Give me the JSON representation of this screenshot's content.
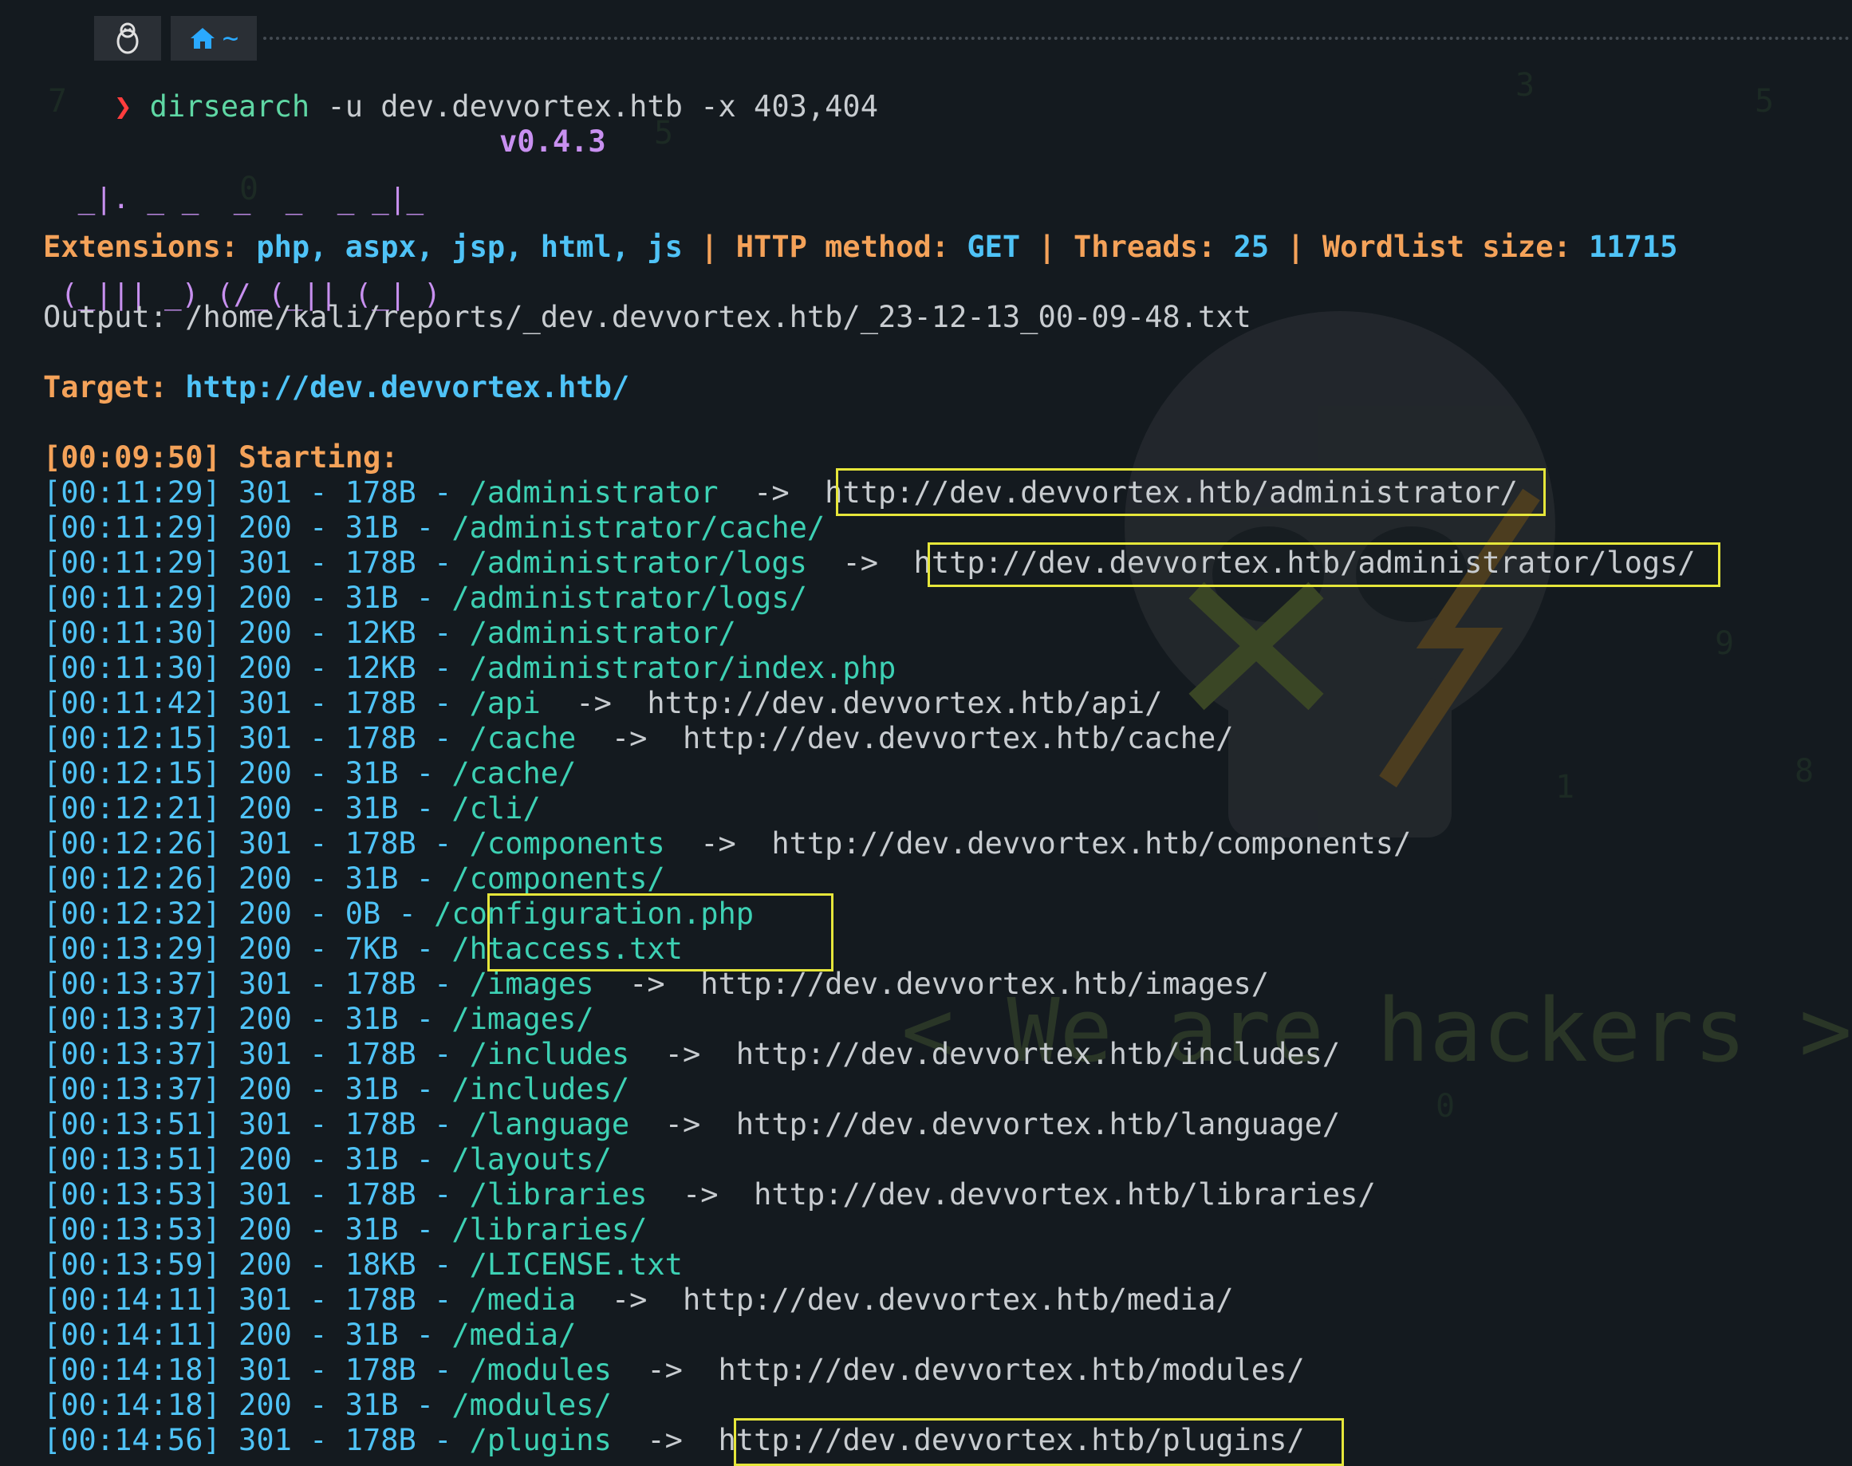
{
  "prompt": {
    "os_icon": "linux-penguin-icon",
    "home_icon": "home-icon",
    "cwd": "~"
  },
  "command": {
    "arrow": "❯",
    "name": "dirsearch",
    "args": " -u dev.devvortex.htb -x 403,404"
  },
  "banner": {
    "art_line1": " _|. _ _  _  _  _ _|_",
    "art_line2": "(_||| _) (/_(_|| (_| )",
    "version": "v0.4.3"
  },
  "config": {
    "extensions_label": "Extensions: ",
    "extensions": "php, aspx, jsp, html, js",
    "sep": " | ",
    "method_label": "HTTP method: ",
    "method": "GET",
    "threads_label": "Threads: ",
    "threads": "25",
    "wordlist_label": "Wordlist size: ",
    "wordlist": "11715"
  },
  "output": {
    "label": "Output: ",
    "path": "/home/kali/reports/_dev.devvortex.htb/_23-12-13_00-09-48.txt"
  },
  "target": {
    "label": "Target: ",
    "url": "http://dev.devvortex.htb/"
  },
  "start": {
    "time": "[00:09:50]",
    "label": " Starting:"
  },
  "results": [
    {
      "time": "[00:11:29]",
      "code": "301",
      "size": "178B",
      "path": "/administrator",
      "redirect": "http://dev.devvortex.htb/administrator/"
    },
    {
      "time": "[00:11:29]",
      "code": "200",
      "size": "31B",
      "path": "/administrator/cache/",
      "redirect": ""
    },
    {
      "time": "[00:11:29]",
      "code": "301",
      "size": "178B",
      "path": "/administrator/logs",
      "redirect": "http://dev.devvortex.htb/administrator/logs/"
    },
    {
      "time": "[00:11:29]",
      "code": "200",
      "size": "31B",
      "path": "/administrator/logs/",
      "redirect": ""
    },
    {
      "time": "[00:11:30]",
      "code": "200",
      "size": "12KB",
      "path": "/administrator/",
      "redirect": ""
    },
    {
      "time": "[00:11:30]",
      "code": "200",
      "size": "12KB",
      "path": "/administrator/index.php",
      "redirect": ""
    },
    {
      "time": "[00:11:42]",
      "code": "301",
      "size": "178B",
      "path": "/api",
      "redirect": "http://dev.devvortex.htb/api/"
    },
    {
      "time": "[00:12:15]",
      "code": "301",
      "size": "178B",
      "path": "/cache",
      "redirect": "http://dev.devvortex.htb/cache/"
    },
    {
      "time": "[00:12:15]",
      "code": "200",
      "size": "31B",
      "path": "/cache/",
      "redirect": ""
    },
    {
      "time": "[00:12:21]",
      "code": "200",
      "size": "31B",
      "path": "/cli/",
      "redirect": ""
    },
    {
      "time": "[00:12:26]",
      "code": "301",
      "size": "178B",
      "path": "/components",
      "redirect": "http://dev.devvortex.htb/components/"
    },
    {
      "time": "[00:12:26]",
      "code": "200",
      "size": "31B",
      "path": "/components/",
      "redirect": ""
    },
    {
      "time": "[00:12:32]",
      "code": "200",
      "size": "0B",
      "path": "/configuration.php",
      "redirect": ""
    },
    {
      "time": "[00:13:29]",
      "code": "200",
      "size": "7KB",
      "path": "/htaccess.txt",
      "redirect": ""
    },
    {
      "time": "[00:13:37]",
      "code": "301",
      "size": "178B",
      "path": "/images",
      "redirect": "http://dev.devvortex.htb/images/"
    },
    {
      "time": "[00:13:37]",
      "code": "200",
      "size": "31B",
      "path": "/images/",
      "redirect": ""
    },
    {
      "time": "[00:13:37]",
      "code": "301",
      "size": "178B",
      "path": "/includes",
      "redirect": "http://dev.devvortex.htb/includes/"
    },
    {
      "time": "[00:13:37]",
      "code": "200",
      "size": "31B",
      "path": "/includes/",
      "redirect": ""
    },
    {
      "time": "[00:13:51]",
      "code": "301",
      "size": "178B",
      "path": "/language",
      "redirect": "http://dev.devvortex.htb/language/"
    },
    {
      "time": "[00:13:51]",
      "code": "200",
      "size": "31B",
      "path": "/layouts/",
      "redirect": ""
    },
    {
      "time": "[00:13:53]",
      "code": "301",
      "size": "178B",
      "path": "/libraries",
      "redirect": "http://dev.devvortex.htb/libraries/"
    },
    {
      "time": "[00:13:53]",
      "code": "200",
      "size": "31B",
      "path": "/libraries/",
      "redirect": ""
    },
    {
      "time": "[00:13:59]",
      "code": "200",
      "size": "18KB",
      "path": "/LICENSE.txt",
      "redirect": ""
    },
    {
      "time": "[00:14:11]",
      "code": "301",
      "size": "178B",
      "path": "/media",
      "redirect": "http://dev.devvortex.htb/media/"
    },
    {
      "time": "[00:14:11]",
      "code": "200",
      "size": "31B",
      "path": "/media/",
      "redirect": ""
    },
    {
      "time": "[00:14:18]",
      "code": "301",
      "size": "178B",
      "path": "/modules",
      "redirect": "http://dev.devvortex.htb/modules/"
    },
    {
      "time": "[00:14:18]",
      "code": "200",
      "size": "31B",
      "path": "/modules/",
      "redirect": ""
    },
    {
      "time": "[00:14:56]",
      "code": "301",
      "size": "178B",
      "path": "/plugins",
      "redirect": "http://dev.devvortex.htb/plugins/"
    }
  ],
  "wallpaper": {
    "text": "< We are hackers >"
  },
  "colors": {
    "background": "#141a1f",
    "highlight_box": "#e6e63a",
    "timestamp": "#4fc3f7",
    "path": "#3dd1b4",
    "label_orange": "#f4a259",
    "version_purple": "#c890f0",
    "prompt_arrow": "#ff3d3d"
  }
}
